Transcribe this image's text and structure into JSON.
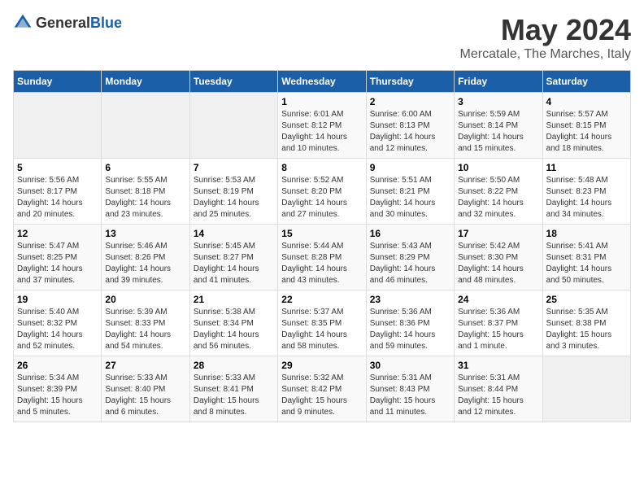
{
  "header": {
    "logo_general": "General",
    "logo_blue": "Blue",
    "month_year": "May 2024",
    "location": "Mercatale, The Marches, Italy"
  },
  "weekdays": [
    "Sunday",
    "Monday",
    "Tuesday",
    "Wednesday",
    "Thursday",
    "Friday",
    "Saturday"
  ],
  "weeks": [
    [
      {
        "day": "",
        "sunrise": "",
        "sunset": "",
        "daylight": ""
      },
      {
        "day": "",
        "sunrise": "",
        "sunset": "",
        "daylight": ""
      },
      {
        "day": "",
        "sunrise": "",
        "sunset": "",
        "daylight": ""
      },
      {
        "day": "1",
        "sunrise": "Sunrise: 6:01 AM",
        "sunset": "Sunset: 8:12 PM",
        "daylight": "Daylight: 14 hours and 10 minutes."
      },
      {
        "day": "2",
        "sunrise": "Sunrise: 6:00 AM",
        "sunset": "Sunset: 8:13 PM",
        "daylight": "Daylight: 14 hours and 12 minutes."
      },
      {
        "day": "3",
        "sunrise": "Sunrise: 5:59 AM",
        "sunset": "Sunset: 8:14 PM",
        "daylight": "Daylight: 14 hours and 15 minutes."
      },
      {
        "day": "4",
        "sunrise": "Sunrise: 5:57 AM",
        "sunset": "Sunset: 8:15 PM",
        "daylight": "Daylight: 14 hours and 18 minutes."
      }
    ],
    [
      {
        "day": "5",
        "sunrise": "Sunrise: 5:56 AM",
        "sunset": "Sunset: 8:17 PM",
        "daylight": "Daylight: 14 hours and 20 minutes."
      },
      {
        "day": "6",
        "sunrise": "Sunrise: 5:55 AM",
        "sunset": "Sunset: 8:18 PM",
        "daylight": "Daylight: 14 hours and 23 minutes."
      },
      {
        "day": "7",
        "sunrise": "Sunrise: 5:53 AM",
        "sunset": "Sunset: 8:19 PM",
        "daylight": "Daylight: 14 hours and 25 minutes."
      },
      {
        "day": "8",
        "sunrise": "Sunrise: 5:52 AM",
        "sunset": "Sunset: 8:20 PM",
        "daylight": "Daylight: 14 hours and 27 minutes."
      },
      {
        "day": "9",
        "sunrise": "Sunrise: 5:51 AM",
        "sunset": "Sunset: 8:21 PM",
        "daylight": "Daylight: 14 hours and 30 minutes."
      },
      {
        "day": "10",
        "sunrise": "Sunrise: 5:50 AM",
        "sunset": "Sunset: 8:22 PM",
        "daylight": "Daylight: 14 hours and 32 minutes."
      },
      {
        "day": "11",
        "sunrise": "Sunrise: 5:48 AM",
        "sunset": "Sunset: 8:23 PM",
        "daylight": "Daylight: 14 hours and 34 minutes."
      }
    ],
    [
      {
        "day": "12",
        "sunrise": "Sunrise: 5:47 AM",
        "sunset": "Sunset: 8:25 PM",
        "daylight": "Daylight: 14 hours and 37 minutes."
      },
      {
        "day": "13",
        "sunrise": "Sunrise: 5:46 AM",
        "sunset": "Sunset: 8:26 PM",
        "daylight": "Daylight: 14 hours and 39 minutes."
      },
      {
        "day": "14",
        "sunrise": "Sunrise: 5:45 AM",
        "sunset": "Sunset: 8:27 PM",
        "daylight": "Daylight: 14 hours and 41 minutes."
      },
      {
        "day": "15",
        "sunrise": "Sunrise: 5:44 AM",
        "sunset": "Sunset: 8:28 PM",
        "daylight": "Daylight: 14 hours and 43 minutes."
      },
      {
        "day": "16",
        "sunrise": "Sunrise: 5:43 AM",
        "sunset": "Sunset: 8:29 PM",
        "daylight": "Daylight: 14 hours and 46 minutes."
      },
      {
        "day": "17",
        "sunrise": "Sunrise: 5:42 AM",
        "sunset": "Sunset: 8:30 PM",
        "daylight": "Daylight: 14 hours and 48 minutes."
      },
      {
        "day": "18",
        "sunrise": "Sunrise: 5:41 AM",
        "sunset": "Sunset: 8:31 PM",
        "daylight": "Daylight: 14 hours and 50 minutes."
      }
    ],
    [
      {
        "day": "19",
        "sunrise": "Sunrise: 5:40 AM",
        "sunset": "Sunset: 8:32 PM",
        "daylight": "Daylight: 14 hours and 52 minutes."
      },
      {
        "day": "20",
        "sunrise": "Sunrise: 5:39 AM",
        "sunset": "Sunset: 8:33 PM",
        "daylight": "Daylight: 14 hours and 54 minutes."
      },
      {
        "day": "21",
        "sunrise": "Sunrise: 5:38 AM",
        "sunset": "Sunset: 8:34 PM",
        "daylight": "Daylight: 14 hours and 56 minutes."
      },
      {
        "day": "22",
        "sunrise": "Sunrise: 5:37 AM",
        "sunset": "Sunset: 8:35 PM",
        "daylight": "Daylight: 14 hours and 58 minutes."
      },
      {
        "day": "23",
        "sunrise": "Sunrise: 5:36 AM",
        "sunset": "Sunset: 8:36 PM",
        "daylight": "Daylight: 14 hours and 59 minutes."
      },
      {
        "day": "24",
        "sunrise": "Sunrise: 5:36 AM",
        "sunset": "Sunset: 8:37 PM",
        "daylight": "Daylight: 15 hours and 1 minute."
      },
      {
        "day": "25",
        "sunrise": "Sunrise: 5:35 AM",
        "sunset": "Sunset: 8:38 PM",
        "daylight": "Daylight: 15 hours and 3 minutes."
      }
    ],
    [
      {
        "day": "26",
        "sunrise": "Sunrise: 5:34 AM",
        "sunset": "Sunset: 8:39 PM",
        "daylight": "Daylight: 15 hours and 5 minutes."
      },
      {
        "day": "27",
        "sunrise": "Sunrise: 5:33 AM",
        "sunset": "Sunset: 8:40 PM",
        "daylight": "Daylight: 15 hours and 6 minutes."
      },
      {
        "day": "28",
        "sunrise": "Sunrise: 5:33 AM",
        "sunset": "Sunset: 8:41 PM",
        "daylight": "Daylight: 15 hours and 8 minutes."
      },
      {
        "day": "29",
        "sunrise": "Sunrise: 5:32 AM",
        "sunset": "Sunset: 8:42 PM",
        "daylight": "Daylight: 15 hours and 9 minutes."
      },
      {
        "day": "30",
        "sunrise": "Sunrise: 5:31 AM",
        "sunset": "Sunset: 8:43 PM",
        "daylight": "Daylight: 15 hours and 11 minutes."
      },
      {
        "day": "31",
        "sunrise": "Sunrise: 5:31 AM",
        "sunset": "Sunset: 8:44 PM",
        "daylight": "Daylight: 15 hours and 12 minutes."
      },
      {
        "day": "",
        "sunrise": "",
        "sunset": "",
        "daylight": ""
      }
    ]
  ]
}
